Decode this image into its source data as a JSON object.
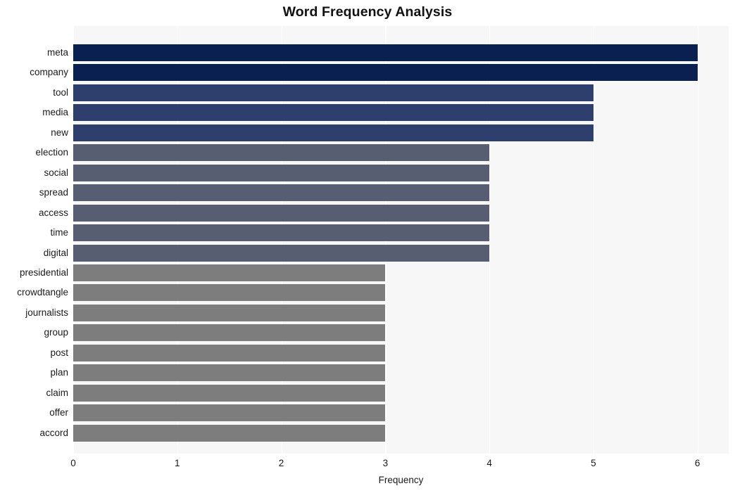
{
  "chart_data": {
    "type": "bar",
    "orientation": "horizontal",
    "title": "Word Frequency Analysis",
    "xlabel": "Frequency",
    "ylabel": "",
    "xlim": [
      0,
      6.3
    ],
    "xticks": [
      0,
      1,
      2,
      3,
      4,
      5,
      6
    ],
    "xtick_labels": [
      "0",
      "1",
      "2",
      "3",
      "4",
      "5",
      "6"
    ],
    "grid": true,
    "grid_axis": "x",
    "legend": false,
    "plot_background": "#f7f7f7",
    "figure_background": "#ffffff",
    "categories": [
      "meta",
      "company",
      "tool",
      "media",
      "new",
      "election",
      "social",
      "spread",
      "access",
      "time",
      "digital",
      "presidential",
      "crowdtangle",
      "journalists",
      "group",
      "post",
      "plan",
      "claim",
      "offer",
      "accord"
    ],
    "values": [
      6,
      6,
      5,
      5,
      5,
      4,
      4,
      4,
      4,
      4,
      4,
      3,
      3,
      3,
      3,
      3,
      3,
      3,
      3,
      3
    ],
    "bar_colors": [
      "#0a2050",
      "#0a2050",
      "#2e3f6e",
      "#2e3f6e",
      "#2e3f6e",
      "#575e72",
      "#575e72",
      "#575e72",
      "#575e72",
      "#575e72",
      "#575e72",
      "#7d7d7d",
      "#7d7d7d",
      "#7d7d7d",
      "#7d7d7d",
      "#7d7d7d",
      "#7d7d7d",
      "#7d7d7d",
      "#7d7d7d",
      "#7d7d7d"
    ],
    "palette": {
      "rank_1": "#0a2050",
      "rank_2": "#2e3f6e",
      "rank_3": "#575e72",
      "rank_4": "#7d7d7d"
    }
  }
}
